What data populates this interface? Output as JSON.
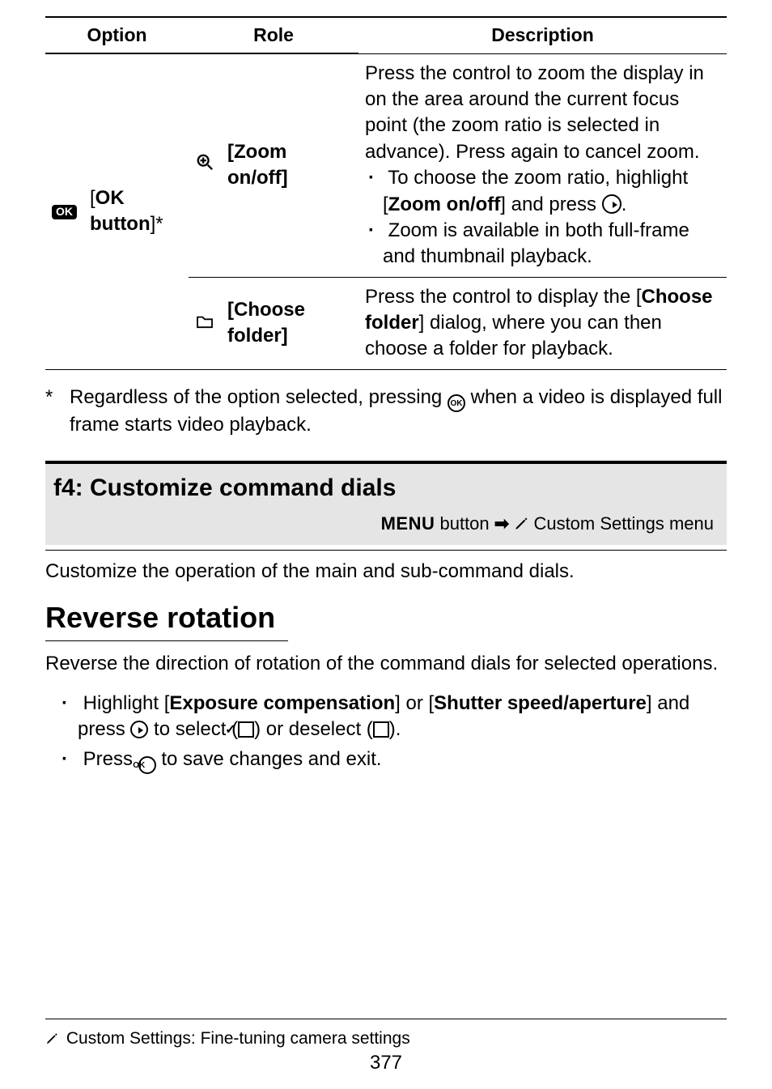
{
  "table": {
    "headers": {
      "option": "Option",
      "role": "Role",
      "description": "Description"
    },
    "row": {
      "option_icon_text": "OK",
      "option_label_prefix": "[",
      "option_label_name": "OK button",
      "option_label_suffix": "]*",
      "roles": [
        {
          "icon": "zoom-in",
          "name": "[Zoom on/off]",
          "desc_intro": "Press the control to zoom the display in on the area around the current focus point (the zoom ratio is selected in advance). Press again to cancel zoom.",
          "desc_bullets": [
            {
              "pre": "To choose the zoom ratio, highlight [",
              "bold": "Zoom on/off",
              "post1": "] and press ",
              "icon": "sel-right",
              "post2": "."
            },
            {
              "pre": "Zoom is available in both full-frame and thumbnail playback."
            }
          ]
        },
        {
          "icon": "folder",
          "name": "[Choose folder]",
          "desc_1": "Press the control to display the [",
          "desc_bold": "Choose folder",
          "desc_2": "] dialog, where you can then choose a folder for playback."
        }
      ]
    }
  },
  "footnote": {
    "marker": "*",
    "text_1": "Regardless of the option selected, pressing ",
    "text_2": " when a video is displayed full frame starts video playback."
  },
  "section": {
    "title": "f4: Customize command dials",
    "path_menu": "MENU",
    "path_rest": " button ",
    "path_end": " Custom Settings menu",
    "intro": "Customize the operation of the main and sub-command dials."
  },
  "reverse": {
    "title": "Reverse rotation",
    "intro": "Reverse the direction of rotation of the command dials for selected operations.",
    "bullets": [
      {
        "pre": "Highlight [",
        "b1": "Exposure compensation",
        "mid": "] or [",
        "b2": "Shutter speed/aperture",
        "post1": "] and press ",
        "post2": " to select (",
        "post3": ") or deselect (",
        "post4": ")."
      },
      {
        "pre": "Press ",
        "post": " to save changes and exit."
      }
    ]
  },
  "footer": {
    "text": "Custom Settings: Fine-tuning camera settings",
    "page": "377"
  }
}
